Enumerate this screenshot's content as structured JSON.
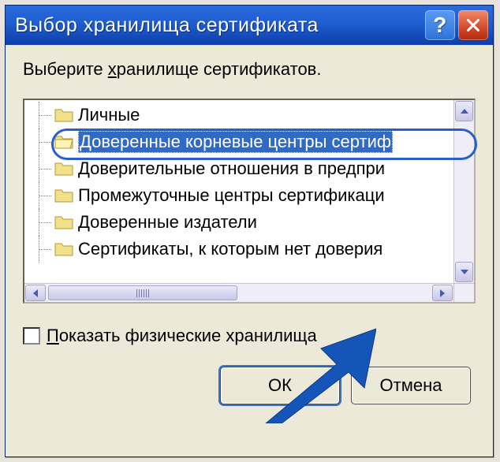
{
  "window": {
    "title": "Выбор хранилища сертификата"
  },
  "instruction": {
    "before": "Выберите ",
    "underline": "х",
    "after": "ранилище сертификатов."
  },
  "tree": {
    "items": [
      {
        "label": "Личные"
      },
      {
        "label": "Доверенные корневые центры сертиф"
      },
      {
        "label": "Доверительные отношения в предпри"
      },
      {
        "label": "Промежуточные центры сертификаци"
      },
      {
        "label": "Доверенные издатели"
      },
      {
        "label": "Сертификаты, к которым нет доверия"
      }
    ],
    "selected_index": 1
  },
  "checkbox": {
    "underline": "П",
    "after": "оказать физические хранилища",
    "checked": false
  },
  "buttons": {
    "ok": "ОК",
    "cancel": "Отмена"
  },
  "titlebar": {
    "help": "?"
  }
}
